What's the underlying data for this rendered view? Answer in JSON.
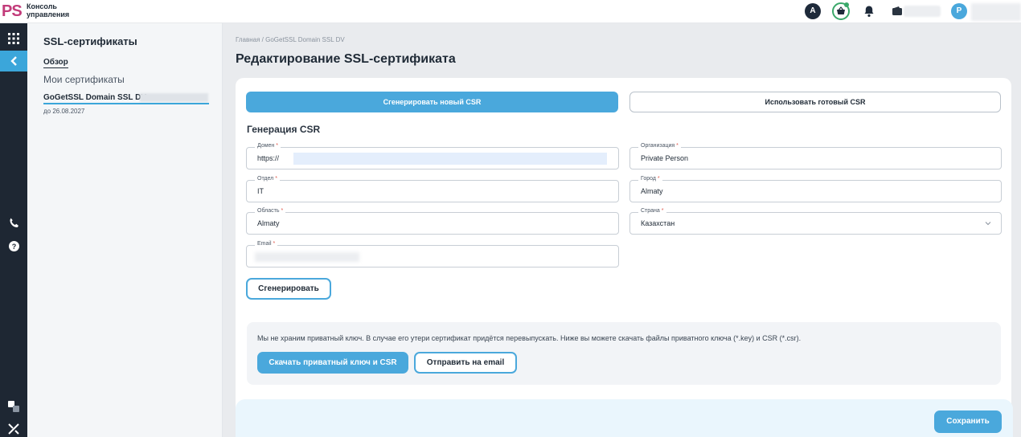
{
  "app": {
    "logo": "PS",
    "title_line1": "Консоль",
    "title_line2": "управления"
  },
  "topbar": {
    "avatar_letter": "A",
    "profile_letter": "P"
  },
  "sidebar": {
    "title": "SSL-сертификаты",
    "overview": "Обзор",
    "my_certificates": "Мои сертификаты",
    "certificate_name": "GoGetSSL Domain SSL DV",
    "valid_until": "до 26.08.2027"
  },
  "main": {
    "breadcrumb": "Главная  /  GoGetSSL Domain SSL DV",
    "page_title": "Редактирование SSL-сертификата",
    "generate_csr_tab": "Сгенерировать новый CSR",
    "use_csr_tab": "Использовать готовый CSR",
    "section_title": "Генерация CSR",
    "fields": {
      "domain": {
        "label": "Домен",
        "value": "https://"
      },
      "organization": {
        "label": "Организация",
        "value": "Private Person"
      },
      "department": {
        "label": "Отдел",
        "value": "IT"
      },
      "city": {
        "label": "Город",
        "value": "Almaty"
      },
      "region": {
        "label": "Область",
        "value": "Almaty"
      },
      "country": {
        "label": "Страна",
        "value": "Казахстан"
      },
      "email": {
        "label": "Email",
        "value": ""
      }
    },
    "generate_button": "Сгенерировать",
    "info_text": "Мы не храним приватный ключ. В случае его утери сертификат придётся перевыпускать. Ниже вы можете скачать файлы приватного ключа (*.key) и CSR (*.csr).",
    "download_button": "Скачать приватный ключ и CSR",
    "send_email_button": "Отправить на email",
    "save_button": "Сохранить"
  },
  "colors": {
    "accent": "#4aa8dc",
    "rail_bg": "#1e2733",
    "required": "#e05a4e"
  }
}
